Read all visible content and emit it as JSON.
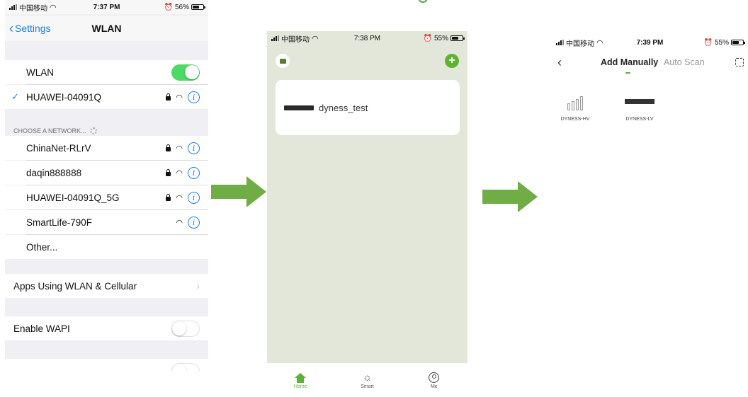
{
  "panel1": {
    "status": {
      "carrier": "中国移动",
      "time": "7:37 PM",
      "battery": "56%"
    },
    "nav": {
      "back_label": "Settings",
      "title": "WLAN"
    },
    "wlan": {
      "label": "WLAN",
      "enabled": true
    },
    "connected": {
      "name": "HUAWEI-04091Q"
    },
    "choose_header": "CHOOSE A NETWORK...",
    "networks": [
      {
        "name": "ChinaNet-RLrV",
        "locked": true
      },
      {
        "name": "daqin888888",
        "locked": true
      },
      {
        "name": "HUAWEI-04091Q_5G",
        "locked": true
      },
      {
        "name": "SmartLife-790F",
        "locked": false
      },
      {
        "name": "Other..."
      }
    ],
    "apps_using": "Apps Using WLAN & Cellular",
    "wapi": {
      "label": "Enable WAPI",
      "enabled": false
    }
  },
  "panel2": {
    "status": {
      "carrier": "中国移动",
      "time": "7:38 PM",
      "battery": "55%"
    },
    "device": {
      "name": "dyness_test"
    },
    "tabs": [
      {
        "label": "Home",
        "icon": "home-icon",
        "active": true
      },
      {
        "label": "Smart",
        "icon": "sun-icon",
        "active": false
      },
      {
        "label": "Me",
        "icon": "user-icon",
        "active": false
      }
    ]
  },
  "panel3": {
    "status": {
      "carrier": "中国移动",
      "time": "7:39 PM",
      "battery": "55%"
    },
    "tabs": {
      "manual": "Add Manually",
      "auto": "Auto Scan"
    },
    "devices": [
      {
        "label": "DYNESS-HV"
      },
      {
        "label": "DYNESS-LV"
      }
    ]
  },
  "colors": {
    "accent_green": "#5fb234",
    "arrow_green": "#70ad47",
    "ios_blue": "#1f7cf2",
    "ios_toggle_green": "#4cd964"
  }
}
